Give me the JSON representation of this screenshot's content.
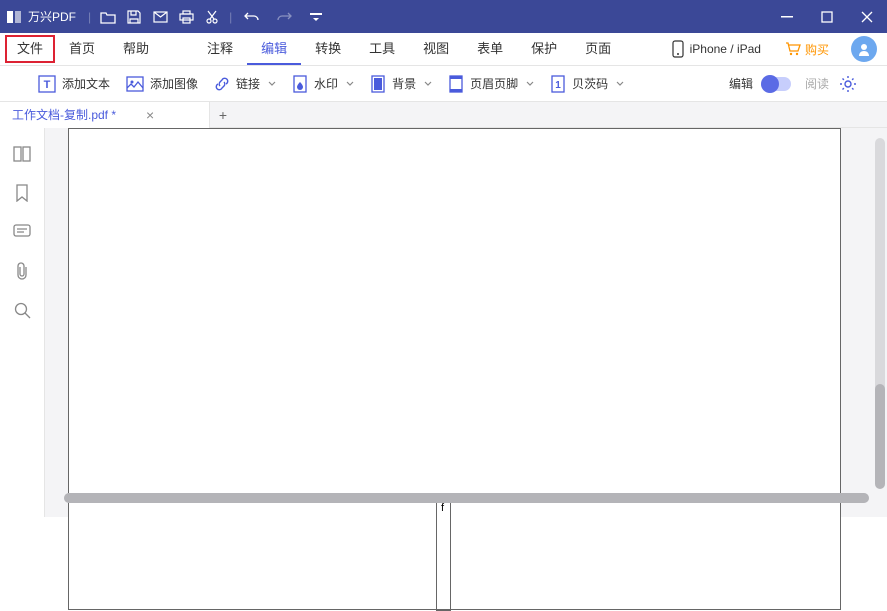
{
  "app": {
    "title": "万兴PDF"
  },
  "menu": {
    "file": "文件",
    "home": "首页",
    "help": "帮助",
    "comment": "注释",
    "edit": "编辑",
    "convert": "转换",
    "tools": "工具",
    "view": "视图",
    "form": "表单",
    "protect": "保护",
    "page": "页面",
    "device": "iPhone / iPad",
    "buy": "购买"
  },
  "toolbar": {
    "add_text": "添加文本",
    "add_image": "添加图像",
    "link": "链接",
    "watermark": "水印",
    "background": "背景",
    "header_footer": "页眉页脚",
    "bates": "贝茨码",
    "mode_edit": "编辑",
    "mode_read": "阅读"
  },
  "tab": {
    "name": "工作文档-复制.pdf *"
  },
  "page": {
    "text": "f"
  }
}
